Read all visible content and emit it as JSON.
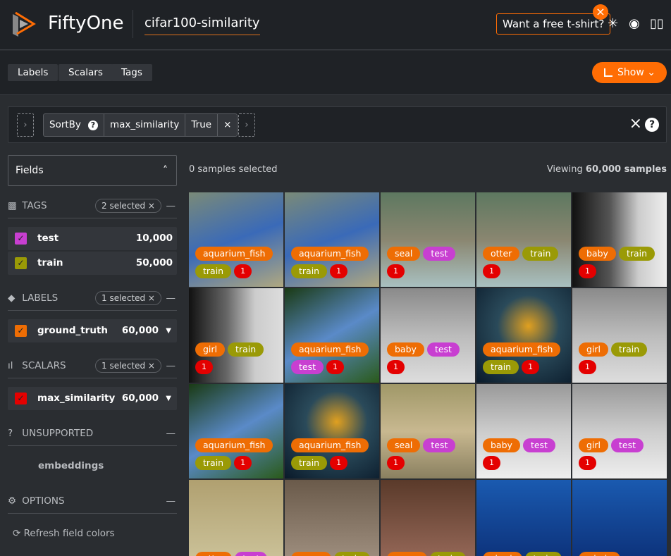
{
  "header": {
    "brand": "FiftyOne",
    "dataset": "cifar100-similarity",
    "tshirt": "Want a free t-shirt?"
  },
  "toolbar": {
    "labels": "Labels",
    "scalars": "Scalars",
    "tags": "Tags",
    "show": "Show"
  },
  "view": {
    "stage": "SortBy",
    "field": "max_similarity",
    "reverse": "True"
  },
  "sidebar": {
    "fields": "Fields",
    "tags": {
      "title": "TAGS",
      "selected": "2 selected ×",
      "items": [
        {
          "name": "test",
          "count": "10,000",
          "color": "#c83fd1"
        },
        {
          "name": "train",
          "count": "50,000",
          "color": "#9a9a06"
        }
      ]
    },
    "labels": {
      "title": "LABELS",
      "selected": "1 selected ×",
      "items": [
        {
          "name": "ground_truth",
          "count": "60,000",
          "color": "#ee6d04"
        }
      ]
    },
    "scalars": {
      "title": "SCALARS",
      "selected": "1 selected ×",
      "items": [
        {
          "name": "max_similarity",
          "count": "60,000",
          "color": "#e40000"
        }
      ]
    },
    "unsupported": {
      "title": "UNSUPPORTED",
      "items": [
        "embeddings"
      ]
    },
    "options": {
      "title": "OPTIONS",
      "refresh": "Refresh field colors"
    }
  },
  "grid": {
    "selected": "0 samples selected",
    "viewing_prefix": "Viewing ",
    "viewing_count": "60,000 samples",
    "tiles": [
      {
        "label": "aquarium_fish",
        "tag": "train",
        "sim": "1",
        "bg": "linear-gradient(160deg,#7a8a78,#3a6ab8 50%,#b0a880)"
      },
      {
        "label": "aquarium_fish",
        "tag": "train",
        "sim": "1",
        "bg": "linear-gradient(160deg,#7a8a78,#3a6ab8 50%,#b0a880)"
      },
      {
        "label": "seal",
        "tag": "test",
        "sim": "1",
        "bg": "linear-gradient(180deg,#5d7860,#8a8670 50%,#a8c0c0)"
      },
      {
        "label": "otter",
        "tag": "train",
        "sim": "1",
        "bg": "linear-gradient(180deg,#5d7860,#8a8670 50%,#a8c0c0)"
      },
      {
        "label": "baby",
        "tag": "train",
        "sim": "1",
        "bg": "linear-gradient(90deg,#111,#555 40%,#ccc 70%,#eee)"
      },
      {
        "label": "girl",
        "tag": "train",
        "sim": "1",
        "bg": "linear-gradient(90deg,#111,#666 40%,#ccc 70%,#ddd)"
      },
      {
        "label": "aquarium_fish",
        "tag": "test",
        "sim": "1",
        "bg": "linear-gradient(150deg,#1a3a14,#5a8ac8 50%,#2a5a1a)"
      },
      {
        "label": "baby",
        "tag": "test",
        "sim": "1",
        "bg": "linear-gradient(180deg,#8a8a8a,#bbb 50%,#ddd)"
      },
      {
        "label": "aquarium_fish",
        "tag": "train",
        "sim": "1",
        "bg": "radial-gradient(circle at 55% 40%,#e0a020,#2a4a5a 40%,#0a1a2a)"
      },
      {
        "label": "girl",
        "tag": "train",
        "sim": "1",
        "bg": "linear-gradient(180deg,#8a8a8a,#bbb 50%,#ddd)"
      },
      {
        "label": "aquarium_fish",
        "tag": "train",
        "sim": "1",
        "bg": "linear-gradient(150deg,#1a3a14,#5a8ac8 50%,#2a5a1a)"
      },
      {
        "label": "aquarium_fish",
        "tag": "train",
        "sim": "1",
        "bg": "radial-gradient(circle at 55% 40%,#e0a020,#2a4a5a 40%,#0a1a2a)"
      },
      {
        "label": "seal",
        "tag": "test",
        "sim": "1",
        "bg": "linear-gradient(180deg,#a09868,#c8b890 50%,#8a8060)"
      },
      {
        "label": "baby",
        "tag": "test",
        "sim": "1",
        "bg": "linear-gradient(180deg,#999,#ccc 50%,#eee)"
      },
      {
        "label": "girl",
        "tag": "test",
        "sim": "1",
        "bg": "linear-gradient(180deg,#999,#ccc 50%,#eee)"
      },
      {
        "label": "otter",
        "tag": "test",
        "sim": "",
        "bg": "linear-gradient(180deg,#b0a070,#d0c8a0)"
      },
      {
        "label": "worm",
        "tag": "train",
        "sim": "",
        "bg": "linear-gradient(180deg,#6a5a4a,#a89888)"
      },
      {
        "label": "worm",
        "tag": "train",
        "sim": "",
        "bg": "linear-gradient(180deg,#5a3a2a,#a07060)"
      },
      {
        "label": "shark",
        "tag": "train",
        "sim": "",
        "bg": "linear-gradient(180deg,#1a5ab0,#0a2a70)"
      },
      {
        "label": "whale",
        "tag": "",
        "sim": "",
        "bg": "linear-gradient(180deg,#1a5ab0,#0a2a70)"
      }
    ]
  },
  "colors": {
    "label": "#ee6d04",
    "train": "#9a9a06",
    "test": "#c83fd1",
    "sim": "#e40000",
    "accent": "#ff6d04"
  }
}
